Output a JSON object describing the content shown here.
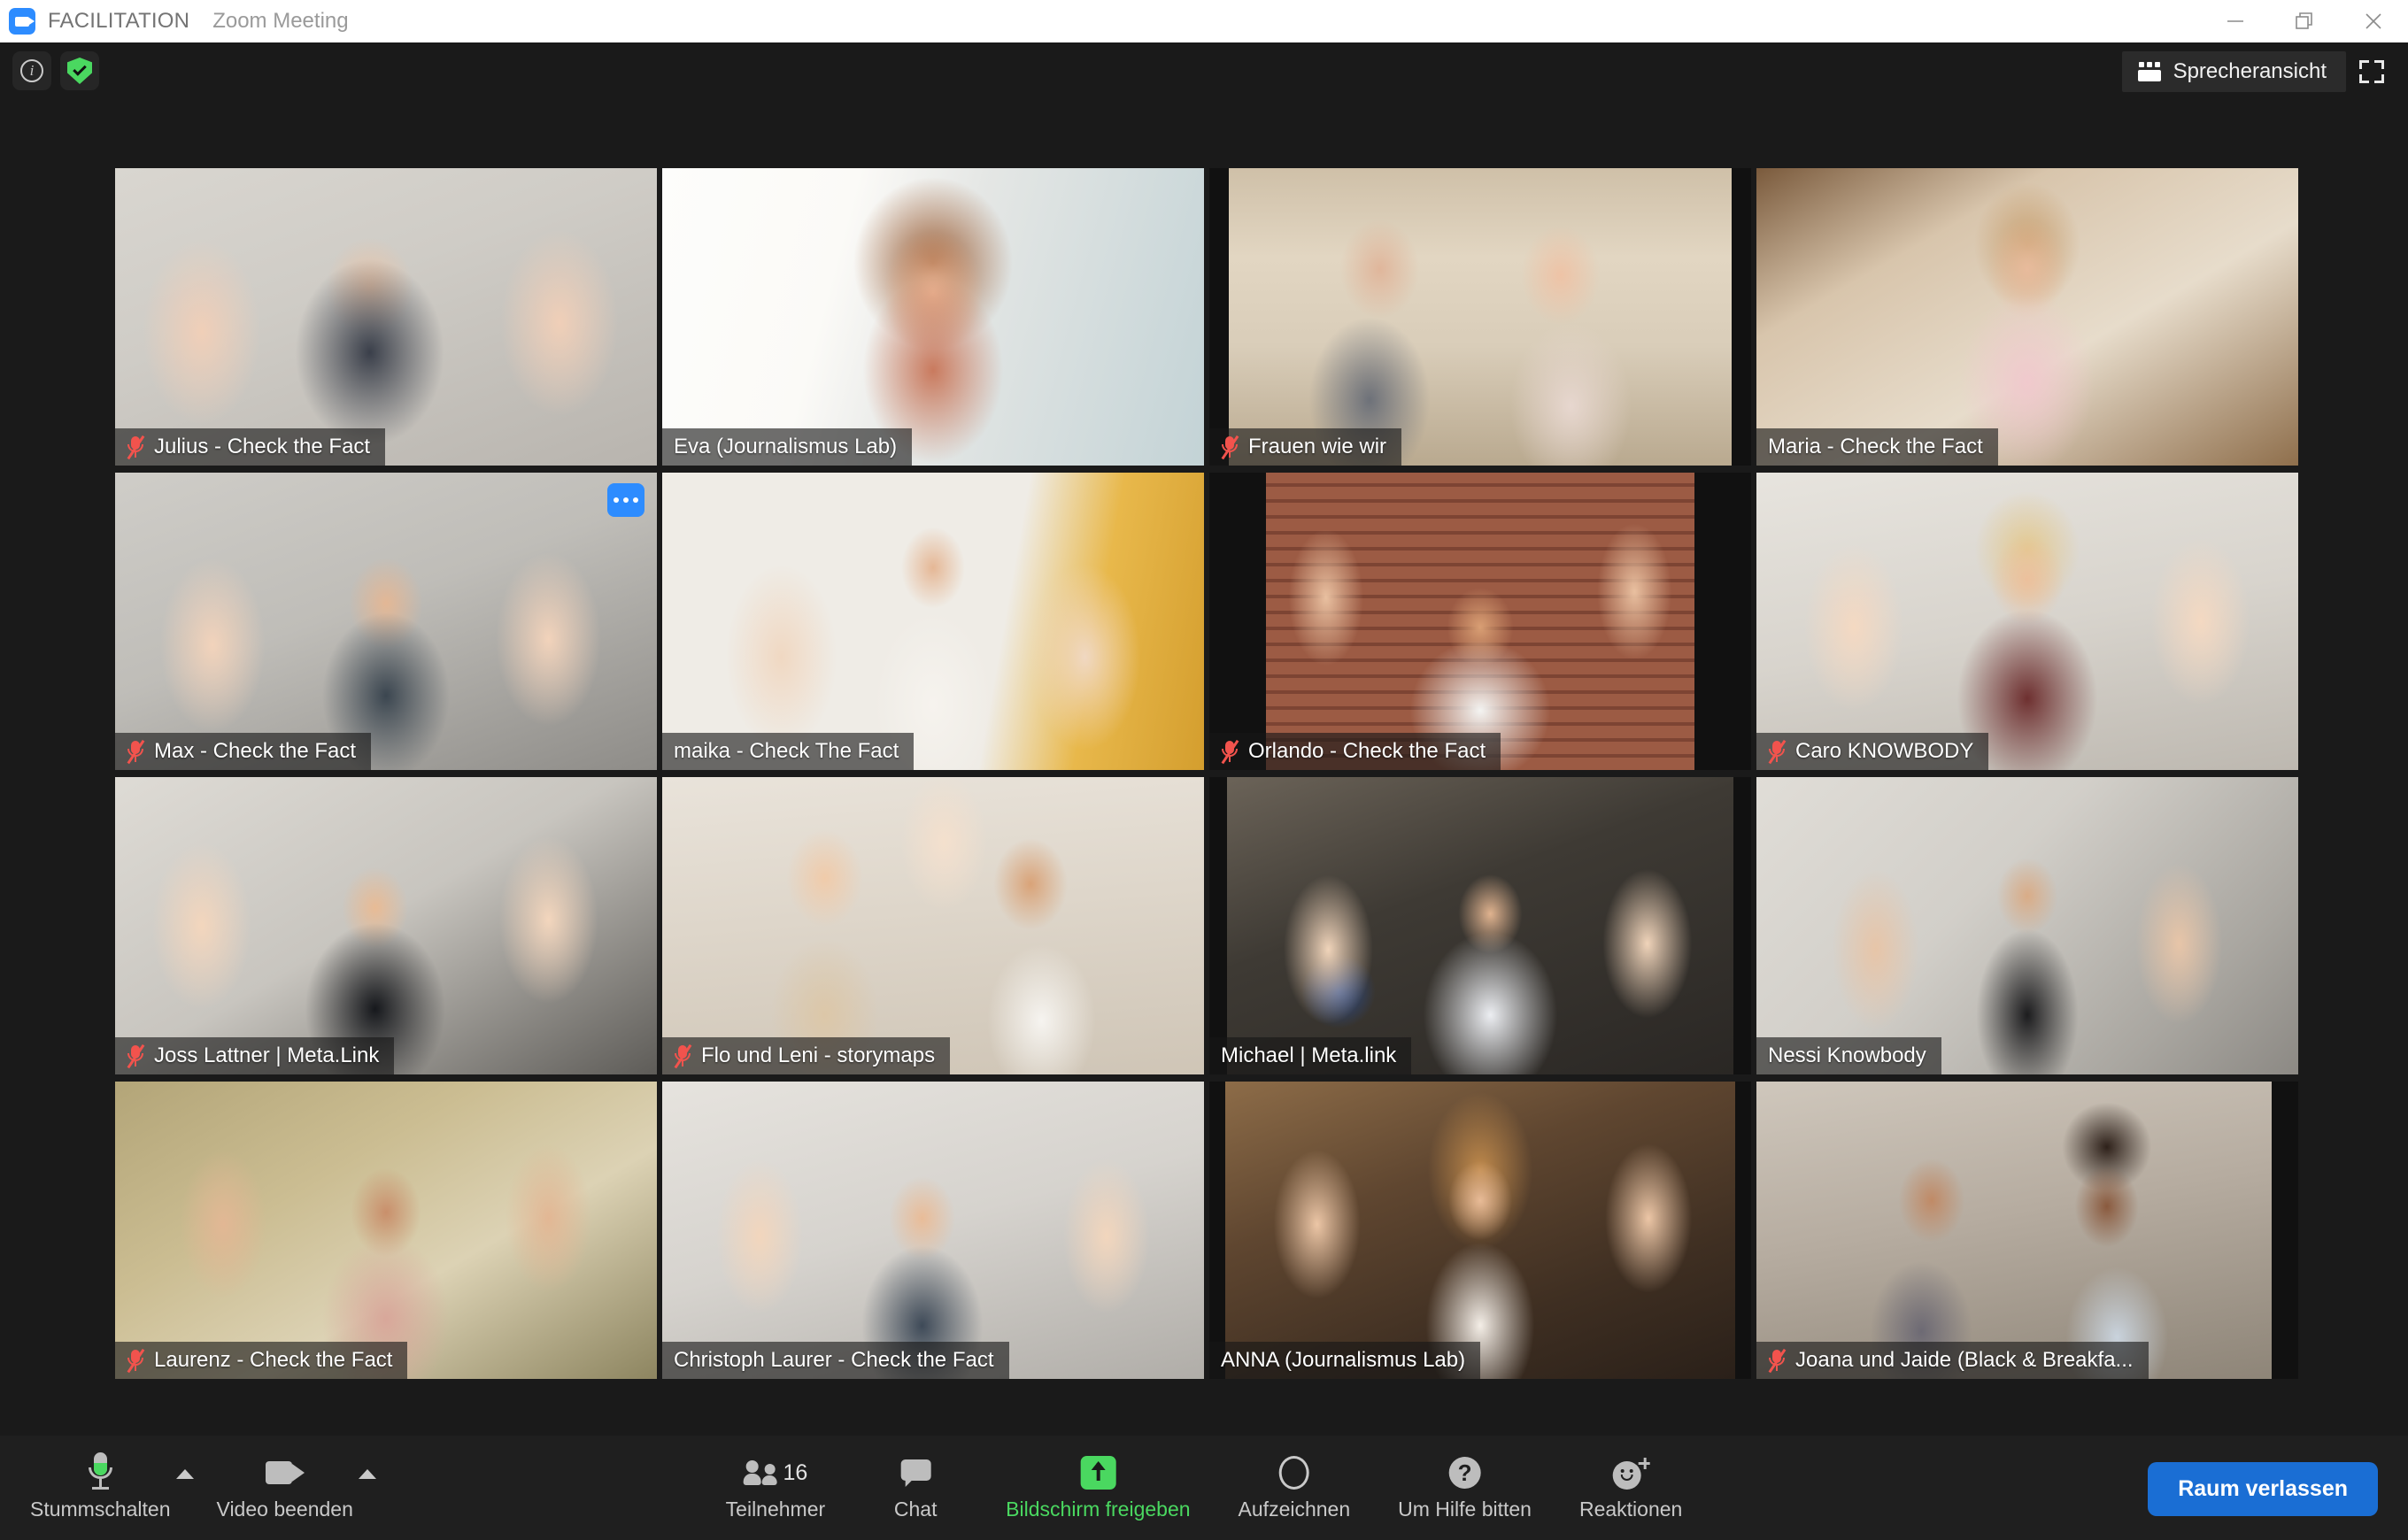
{
  "titlebar": {
    "app_name": "FACILITATION",
    "meeting_label": "Zoom Meeting",
    "logo_icon": "zoom-camera-icon",
    "minimize_icon": "minimize-icon",
    "restore_icon": "restore-icon",
    "close_icon": "close-icon"
  },
  "header": {
    "info_icon": "info-icon",
    "encryption_icon": "shield-check-icon",
    "view_button_label": "Sprecheransicht",
    "view_button_icon": "grid-view-icon",
    "fullscreen_icon": "fullscreen-icon"
  },
  "gallery": {
    "active_speaker_border_color": "#c7e83f",
    "more_options_label": "•••",
    "participants": [
      {
        "name": "Julius - Check the Fact",
        "muted": true,
        "active": false
      },
      {
        "name": "Eva (Journalismus Lab)",
        "muted": false,
        "active": true
      },
      {
        "name": "Frauen wie wir",
        "muted": true,
        "active": false
      },
      {
        "name": "Maria - Check the Fact",
        "muted": false,
        "active": false
      },
      {
        "name": "Max - Check the Fact",
        "muted": true,
        "active": false
      },
      {
        "name": "maika - Check The Fact",
        "muted": false,
        "active": false
      },
      {
        "name": "Orlando - Check the Fact",
        "muted": true,
        "active": false
      },
      {
        "name": "Caro KNOWBODY",
        "muted": true,
        "active": false
      },
      {
        "name": "Joss Lattner | Meta.Link",
        "muted": true,
        "active": false
      },
      {
        "name": "Flo und Leni - storymaps",
        "muted": true,
        "active": false
      },
      {
        "name": "Michael | Meta.link",
        "muted": false,
        "active": false
      },
      {
        "name": "Nessi Knowbody",
        "muted": false,
        "active": false
      },
      {
        "name": "Laurenz - Check the Fact",
        "muted": true,
        "active": false
      },
      {
        "name": "Christoph Laurer - Check the Fact",
        "muted": false,
        "active": false
      },
      {
        "name": "ANNA (Journalismus Lab)",
        "muted": false,
        "active": false
      },
      {
        "name": "Joana und Jaide (Black & Breakfa...",
        "muted": true,
        "active": false
      }
    ]
  },
  "toolbar": {
    "mute_label": "Stummschalten",
    "mute_icon": "microphone-icon",
    "video_label": "Video beenden",
    "video_icon": "camera-icon",
    "participants_label": "Teilnehmer",
    "participants_count": "16",
    "participants_icon": "people-icon",
    "chat_label": "Chat",
    "chat_icon": "chat-bubble-icon",
    "share_label": "Bildschirm freigeben",
    "share_icon": "share-screen-icon",
    "share_color": "#4ad860",
    "record_label": "Aufzeichnen",
    "record_icon": "record-circle-icon",
    "help_label": "Um Hilfe bitten",
    "help_icon": "question-mark-icon",
    "reactions_label": "Reaktionen",
    "reactions_icon": "smiley-plus-icon",
    "leave_label": "Raum verlassen",
    "leave_color": "#1a6ed4"
  }
}
